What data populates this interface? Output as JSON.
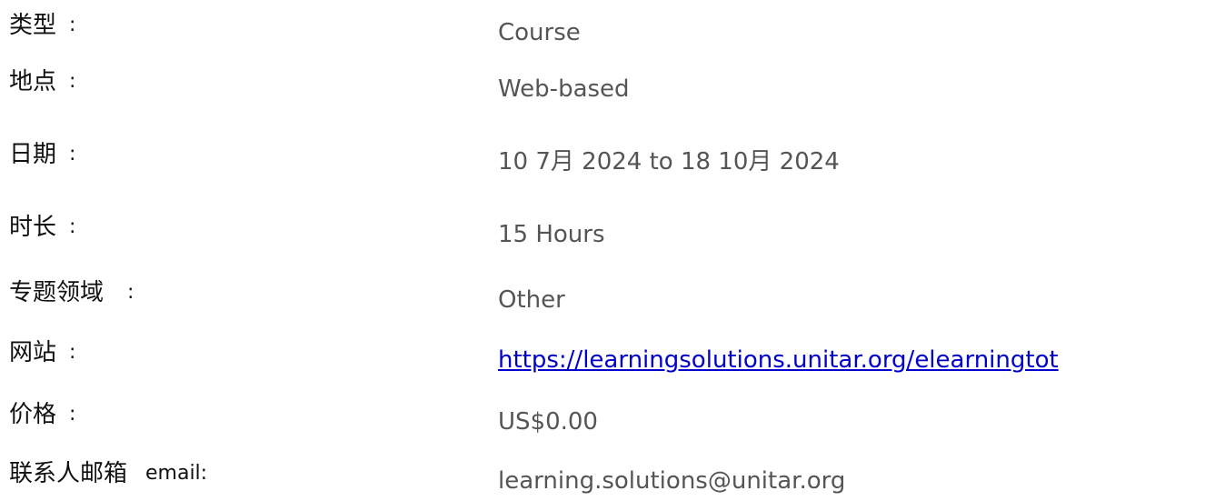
{
  "details": {
    "rows": [
      {
        "label": "类型",
        "colon": ":",
        "value": "Course"
      },
      {
        "label": "地点",
        "colon": ":",
        "value": "Web-based"
      },
      {
        "label": "日期",
        "colon": ":",
        "value": "10 7月 2024 to 18 10月 2024"
      },
      {
        "label": "时长",
        "colon": ":",
        "value": "15 Hours"
      },
      {
        "label": "专题领域",
        "colon": ":",
        "value": "Other"
      },
      {
        "label": "网站",
        "colon": ":",
        "value": "https://learningsolutions.unitar.org/elearningtot"
      },
      {
        "label": "价格",
        "colon": ":",
        "value": "US$0.00"
      },
      {
        "label": "联系人邮箱",
        "colon": "email:",
        "value": "learning.solutions@unitar.org"
      }
    ]
  },
  "colors": {
    "label": "#111111",
    "value": "#555555",
    "link": "#0000cc"
  }
}
